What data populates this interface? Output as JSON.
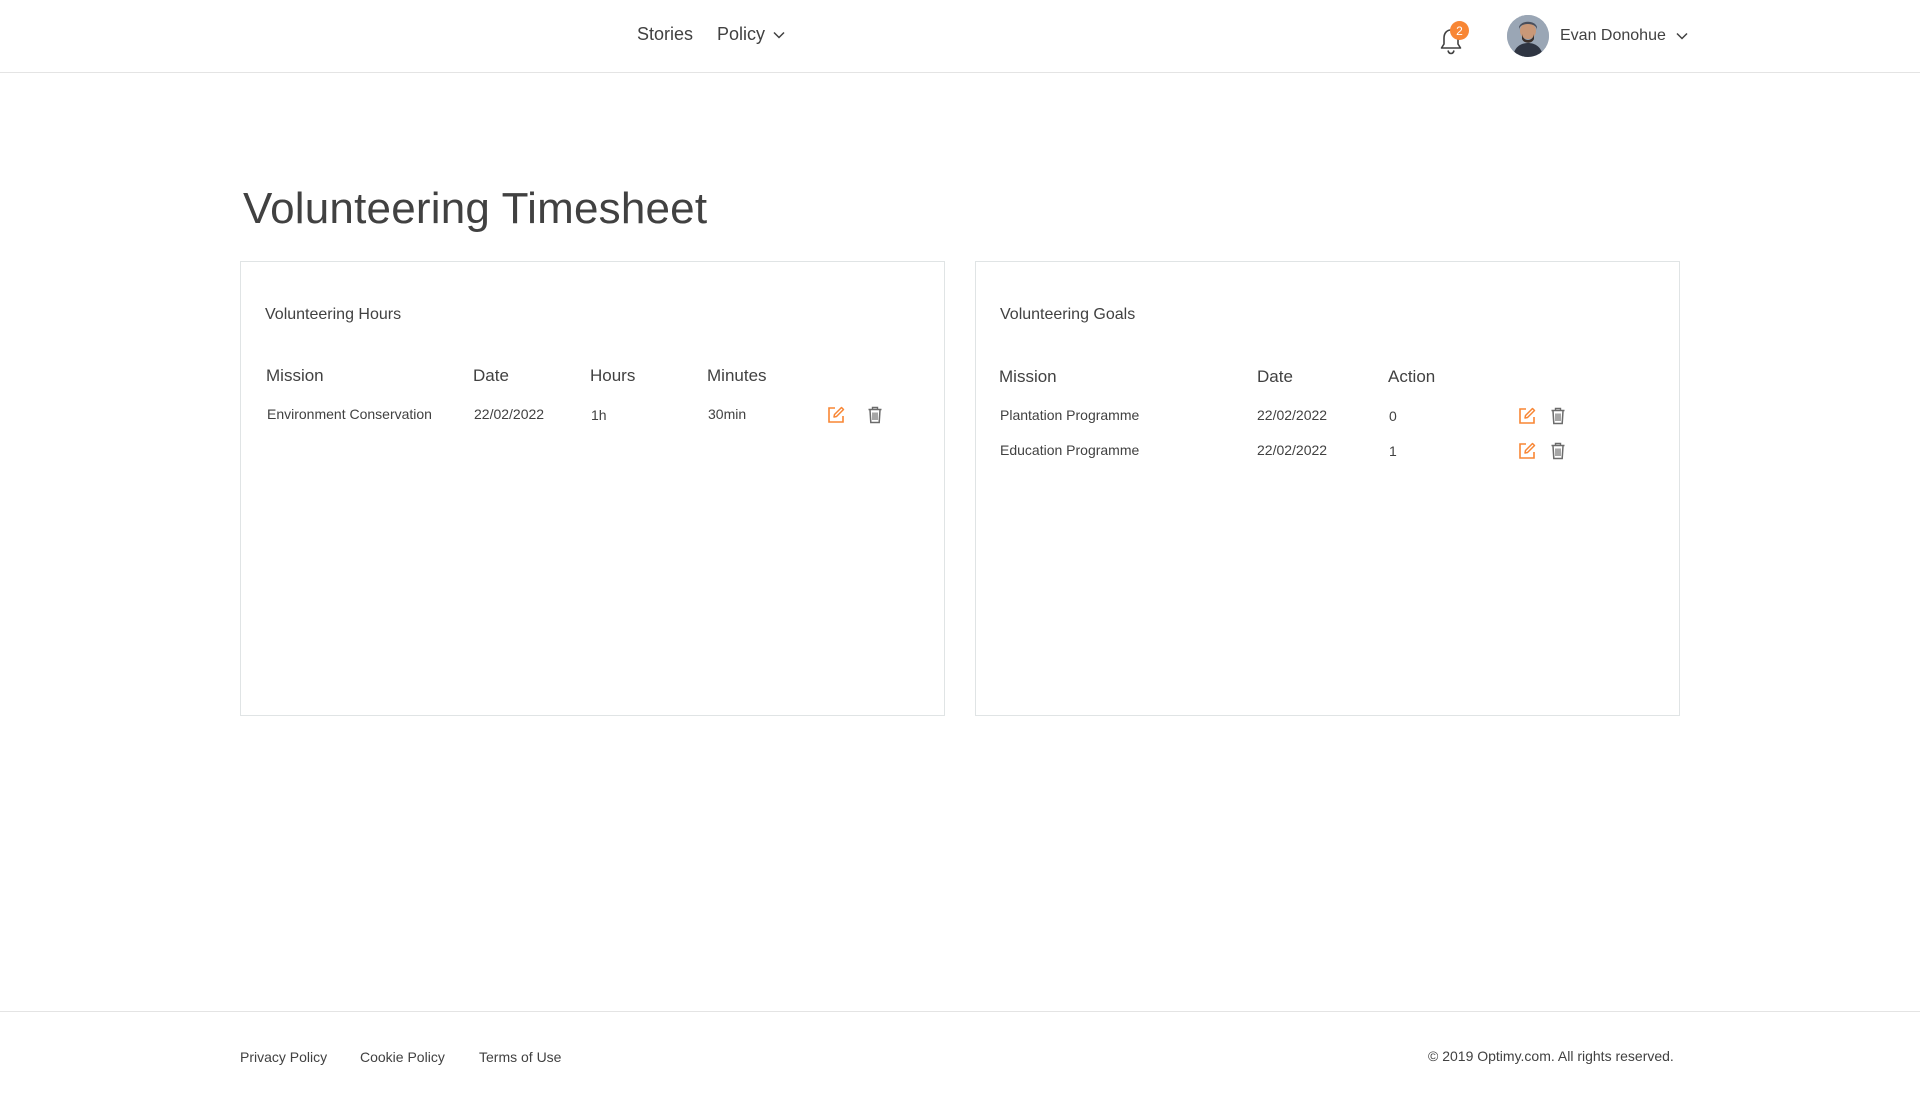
{
  "header": {
    "nav": {
      "stories": "Stories",
      "policy": "Policy"
    },
    "notification_count": "2",
    "user_name": "Evan Donohue"
  },
  "page": {
    "title": "Volunteering Timesheet"
  },
  "hours_card": {
    "title": "Volunteering Hours",
    "columns": [
      "Mission",
      "Date",
      "Hours",
      "Minutes"
    ],
    "rows": [
      {
        "mission": "Environment Conservation",
        "date": "22/02/2022",
        "hours": "1h",
        "minutes": "30min"
      }
    ]
  },
  "goals_card": {
    "title": "Volunteering Goals",
    "columns": [
      "Mission",
      "Date",
      "Action"
    ],
    "rows": [
      {
        "mission": "Plantation Programme",
        "date": "22/02/2022",
        "action": "0"
      },
      {
        "mission": "Education Programme",
        "date": "22/02/2022",
        "action": "1"
      }
    ]
  },
  "footer": {
    "privacy": "Privacy Policy",
    "cookie": "Cookie Policy",
    "terms": "Terms of Use",
    "copyright": "© 2019 Optimy.com. All rights reserved."
  },
  "colors": {
    "accent": "#f88634",
    "text": "#414141",
    "border": "#e0e4e5"
  },
  "icons": {
    "edit": "edit-icon",
    "delete": "trash-icon",
    "bell": "bell-icon",
    "chevron": "chevron-down-icon"
  }
}
